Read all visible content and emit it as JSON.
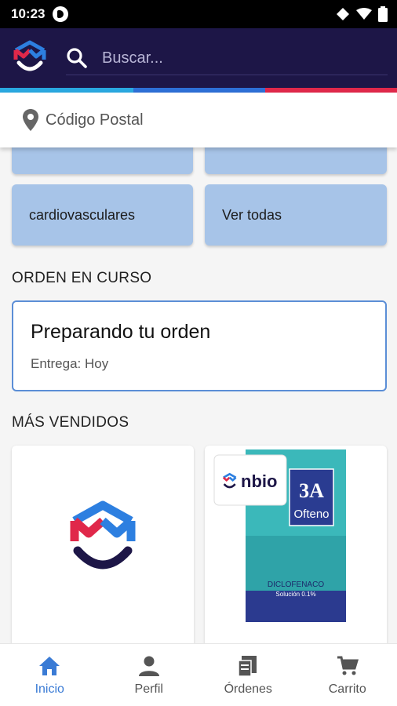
{
  "status_bar": {
    "time": "10:23"
  },
  "header": {
    "search_placeholder": "Buscar..."
  },
  "colors": {
    "header_bg": "#1d1647",
    "accent_blue": "#3a7bd5",
    "accent_light": "#29a8e0",
    "accent_red": "#e0284a",
    "category_bg": "#a7c4e8"
  },
  "postal": {
    "label": "Código Postal"
  },
  "categories": [
    {
      "label": ""
    },
    {
      "label": ""
    },
    {
      "label": "cardiovasculares"
    },
    {
      "label": "Ver todas"
    }
  ],
  "order_section": {
    "title": "ORDEN EN CURSO",
    "order_title": "Preparando tu orden",
    "order_subtitle": "Entrega: Hoy"
  },
  "best_sellers": {
    "title": "MÁS VENDIDOS",
    "products": [
      {
        "image": "brand-logo"
      },
      {
        "badge": "nbio",
        "box_brand": "3A",
        "box_name": "Ofteno",
        "box_drug": "DICLOFENACO",
        "box_strength": "Solución 0.1%"
      }
    ]
  },
  "bottom_nav": [
    {
      "label": "Inicio",
      "icon": "home-icon",
      "active": true
    },
    {
      "label": "Perfil",
      "icon": "person-icon",
      "active": false
    },
    {
      "label": "Órdenes",
      "icon": "orders-icon",
      "active": false
    },
    {
      "label": "Carrito",
      "icon": "cart-icon",
      "active": false
    }
  ]
}
